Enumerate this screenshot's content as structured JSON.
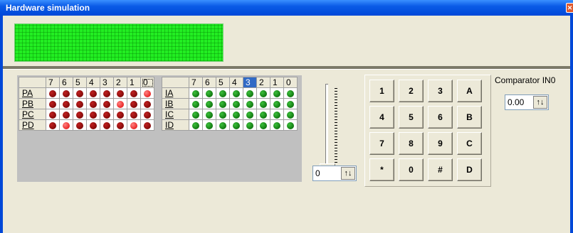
{
  "window": {
    "title": "Hardware simulation"
  },
  "ports_out": {
    "bits": [
      "7",
      "6",
      "5",
      "4",
      "3",
      "2",
      "1",
      "0"
    ],
    "rows": [
      {
        "label": "PA",
        "leds": [
          "red",
          "red",
          "red",
          "red",
          "red",
          "red",
          "red",
          "redon"
        ]
      },
      {
        "label": "PB",
        "leds": [
          "red",
          "red",
          "red",
          "red",
          "red",
          "redon",
          "red",
          "red"
        ]
      },
      {
        "label": "PC",
        "leds": [
          "red",
          "red",
          "red",
          "red",
          "red",
          "red",
          "red",
          "red"
        ]
      },
      {
        "label": "PD",
        "leds": [
          "red",
          "redon",
          "red",
          "red",
          "red",
          "red",
          "redon",
          "red"
        ]
      }
    ]
  },
  "ports_in": {
    "bits": [
      "7",
      "6",
      "5",
      "4",
      "3",
      "2",
      "1",
      "0"
    ],
    "selected_bit_index": 4,
    "rows": [
      {
        "label": "IA",
        "leds": [
          "green",
          "green",
          "green",
          "green",
          "green",
          "green",
          "green",
          "green"
        ]
      },
      {
        "label": "IB",
        "leds": [
          "green",
          "green",
          "green",
          "green",
          "green",
          "green",
          "green",
          "green"
        ]
      },
      {
        "label": "IC",
        "leds": [
          "green",
          "green",
          "green",
          "green",
          "green",
          "green",
          "green",
          "green"
        ]
      },
      {
        "label": "ID",
        "leds": [
          "green",
          "green",
          "green",
          "green",
          "green",
          "green",
          "green",
          "green"
        ]
      }
    ]
  },
  "slider": {
    "value": "0"
  },
  "keypad": {
    "keys": [
      [
        "1",
        "2",
        "3",
        "A"
      ],
      [
        "4",
        "5",
        "6",
        "B"
      ],
      [
        "7",
        "8",
        "9",
        "C"
      ],
      [
        "*",
        "0",
        "#",
        "D"
      ]
    ]
  },
  "comparator": {
    "label": "Comparator IN0",
    "value": "0.00"
  },
  "colors": {
    "titlebar": "#0a5ae6",
    "lcd": "#22ee22",
    "led_off": "#8b0000",
    "led_on": "#ff2020",
    "led_green": "#1a8a1a",
    "selection": "#316ac5"
  }
}
